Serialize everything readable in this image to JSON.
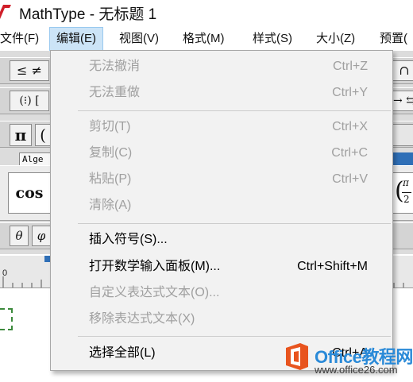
{
  "window": {
    "title": "MathType - 无标题 1"
  },
  "menubar": [
    {
      "label": "文件(F)"
    },
    {
      "label": "编辑(E)"
    },
    {
      "label": "视图(V)"
    },
    {
      "label": "格式(M)"
    },
    {
      "label": "样式(S)"
    },
    {
      "label": "大小(Z)"
    },
    {
      "label": "预置("
    }
  ],
  "toolbar": {
    "row1_left": "≤ ≠",
    "row1_right": "∩",
    "row2_left": "(⁝) [",
    "row2_right": "→ ⇆",
    "row3_pi": "π",
    "row3_paren": "(",
    "tab_algebra": "Alge",
    "cos": "cos",
    "cos_suffix": "",
    "frac_num": "π",
    "frac_den": "2",
    "theta": "θ",
    "phi": "φ"
  },
  "ruler": {
    "zero_label": "0"
  },
  "edit_menu": {
    "undo": {
      "label": "无法撤消",
      "shortcut": "Ctrl+Z"
    },
    "redo": {
      "label": "无法重做",
      "shortcut": "Ctrl+Y"
    },
    "cut": {
      "label": "剪切(T)",
      "shortcut": "Ctrl+X"
    },
    "copy": {
      "label": "复制(C)",
      "shortcut": "Ctrl+C"
    },
    "paste": {
      "label": "粘贴(P)",
      "shortcut": "Ctrl+V"
    },
    "clear": {
      "label": "清除(A)",
      "shortcut": ""
    },
    "insert_symbol": {
      "label": "插入符号(S)...",
      "shortcut": ""
    },
    "math_input": {
      "label": "打开数学输入面板(M)...",
      "shortcut": "Ctrl+Shift+M"
    },
    "custom_text": {
      "label": "自定义表达式文本(O)...",
      "shortcut": ""
    },
    "remove_text": {
      "label": "移除表达式文本(X)",
      "shortcut": ""
    },
    "select_all": {
      "label": "选择全部(L)",
      "shortcut": "Ctrl+A"
    }
  },
  "watermark": {
    "name": "Office教程网",
    "url": "www.office26.com"
  },
  "colors": {
    "menu_active": "#cce4f7",
    "disabled_text": "#a0a0a0",
    "watermark_orange": "#e8541e",
    "watermark_blue": "#2a8ad8"
  }
}
